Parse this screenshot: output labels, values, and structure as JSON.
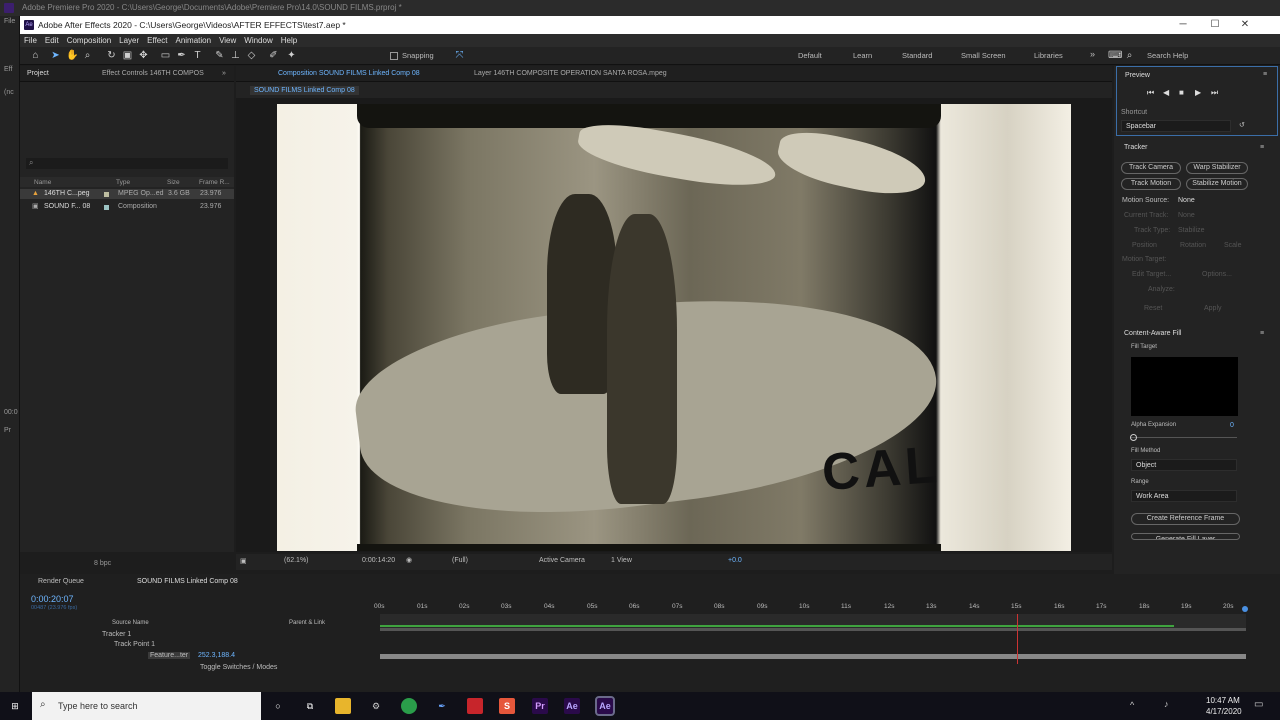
{
  "premiere": {
    "title": "Adobe Premiere Pro 2020 - C:\\Users\\George\\Documents\\Adobe\\Premiere Pro\\14.0\\SOUND FILMS.prproj *",
    "side_labels": [
      "File",
      "Eff",
      "(nc",
      "00:0",
      "Pr"
    ]
  },
  "window": {
    "title": "Adobe After Effects 2020 - C:\\Users\\George\\Videos\\AFTER EFFECTS\\test7.aep *",
    "app_icon": "Ae",
    "minimize": "─",
    "maximize": "☐",
    "close": "✕"
  },
  "menu": [
    "File",
    "Edit",
    "Composition",
    "Layer",
    "Effect",
    "Animation",
    "View",
    "Window",
    "Help"
  ],
  "toolbar": {
    "snapping": "Snapping",
    "workspaces": [
      "Default",
      "Learn",
      "Standard",
      "Small Screen",
      "Libraries"
    ],
    "more": "»",
    "search_help": "Search Help"
  },
  "project": {
    "tab": "Project",
    "effect_controls_tab": "Effect Controls 146TH COMPOS",
    "columns": [
      "Name",
      "Type",
      "Size",
      "Frame R..."
    ],
    "items": [
      {
        "name": "146TH C...peg",
        "type": "MPEG Op...ed",
        "size": "3.6 GB",
        "rate": "23.976"
      },
      {
        "name": "SOUND F... 08",
        "type": "Composition",
        "size": "",
        "rate": "23.976"
      }
    ],
    "bpc": "8 bpc"
  },
  "composition": {
    "tab": "Composition SOUND FILMS Linked Comp 08",
    "layer_tab": "Layer 146TH COMPOSITE OPERATION SANTA ROSA.mpeg",
    "breadcrumb": "SOUND FILMS Linked Comp 08",
    "zoom": "(62.1%)",
    "timecode": "0:00:14:20",
    "resolution": "(Full)",
    "camera": "Active Camera",
    "views": "1 View",
    "exposure": "+0.0",
    "film_text": "CAL"
  },
  "preview": {
    "title": "Preview",
    "shortcut_label": "Shortcut",
    "shortcut_value": "Spacebar"
  },
  "tracker": {
    "title": "Tracker",
    "buttons": [
      "Track Camera",
      "Warp Stabilizer",
      "Track Motion",
      "Stabilize Motion"
    ],
    "motion_source_label": "Motion Source:",
    "motion_source_value": "None",
    "current_track_label": "Current Track:",
    "current_track_value": "None",
    "track_type_label": "Track Type:",
    "track_type_value": "Stabilize",
    "checks": [
      "Position",
      "Rotation",
      "Scale"
    ],
    "motion_target": "Motion Target:",
    "edit_target": "Edit Target...",
    "options": "Options...",
    "analyze": "Analyze:",
    "reset": "Reset",
    "apply": "Apply"
  },
  "caf": {
    "title": "Content-Aware Fill",
    "fill_target": "Fill Target",
    "alpha_expansion": "Alpha Expansion",
    "alpha_value": "0",
    "fill_method": "Fill Method",
    "fill_method_value": "Object",
    "range": "Range",
    "range_value": "Work Area",
    "create_ref": "Create Reference Frame",
    "generate": "Generate Fill Layer"
  },
  "timeline": {
    "render_queue": "Render Queue",
    "comp_tab": "SOUND FILMS Linked Comp 08",
    "timecode": "0:00:20:07",
    "frame_info": "00487 (23.976 fps)",
    "col_source": "Source Name",
    "col_parent": "Parent & Link",
    "layers": [
      "Tracker 1",
      "Track Point 1",
      "Feature...ter"
    ],
    "feature_value": "252.3,188.4",
    "toggle": "Toggle Switches / Modes",
    "ticks": [
      "00s",
      "01s",
      "02s",
      "03s",
      "04s",
      "05s",
      "06s",
      "07s",
      "08s",
      "09s",
      "10s",
      "11s",
      "12s",
      "13s",
      "14s",
      "15s",
      "16s",
      "17s",
      "18s",
      "19s",
      "20s"
    ]
  },
  "taskbar": {
    "search": "Type here to search",
    "time": "10:47 AM",
    "date": "4/17/2020",
    "apps": [
      "Pr",
      "Ae",
      "Ae"
    ]
  }
}
